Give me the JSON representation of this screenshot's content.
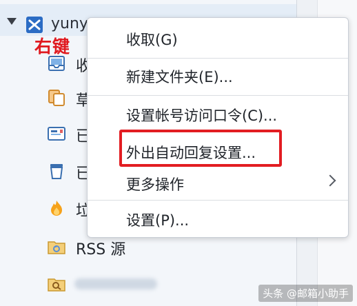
{
  "account": {
    "name": "yuny",
    "right_click_note": "右键"
  },
  "folders": [
    {
      "icon": "inbox-icon",
      "label": "收"
    },
    {
      "icon": "drafts-icon",
      "label": "草"
    },
    {
      "icon": "sent-icon",
      "label": "已"
    },
    {
      "icon": "trash-icon",
      "label": "已"
    },
    {
      "icon": "junk-icon",
      "label": "垃"
    },
    {
      "icon": "rss-folder-icon",
      "label": "RSS 源"
    }
  ],
  "context_menu": {
    "items": [
      {
        "label": "收取(G)"
      },
      {
        "label": "新建文件夹(E)..."
      },
      {
        "label": "设置帐号访问口令(C)..."
      },
      {
        "label": "外出自动回复设置..."
      },
      {
        "label": "更多操作"
      },
      {
        "label": "设置(P)..."
      }
    ]
  },
  "colors": {
    "highlight": "#e21d22",
    "annotation": "#e0191f"
  },
  "watermark": "头条 @邮箱小助手"
}
